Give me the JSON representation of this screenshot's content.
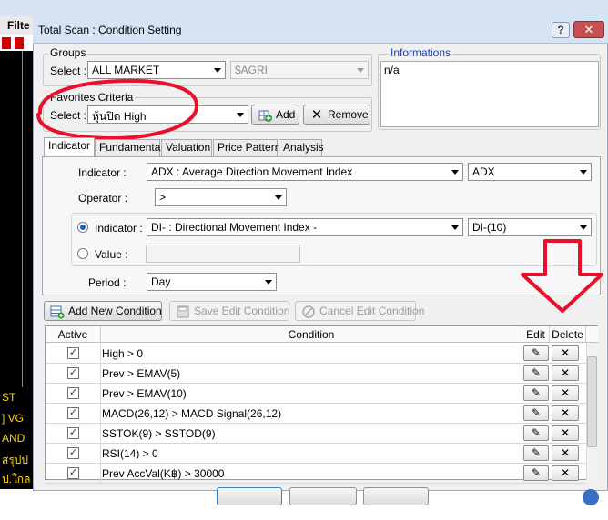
{
  "background_app": {
    "tab_label": "Filte",
    "text_lines": [
      "ST",
      "] VG",
      "AND",
      "สรุปป",
      "ป.ใกล"
    ]
  },
  "dialog": {
    "title": "Total Scan : Condition Setting",
    "help_glyph": "?",
    "close_glyph": "✕"
  },
  "groups": {
    "legend": "Groups",
    "select_label": "Select :",
    "market_value": "ALL MARKET",
    "sector_value": "$AGRI"
  },
  "favorites": {
    "legend": "Favorites Criteria",
    "select_label": "Select :",
    "value": "หุ้นปิด High",
    "add_label": "Add",
    "remove_label": "Remove"
  },
  "informations": {
    "legend": "Informations",
    "text": "n/a"
  },
  "tabs": [
    {
      "label": "Indicator",
      "active": true
    },
    {
      "label": "Fundamental",
      "active": false
    },
    {
      "label": "Valuation",
      "active": false
    },
    {
      "label": "Price Pattern",
      "active": false
    },
    {
      "label": "Analysis",
      "active": false
    }
  ],
  "indicator_tab": {
    "indicator_label": "Indicator :",
    "indicator_value": "ADX : Average Direction Movement Index",
    "indicator_param": "ADX",
    "operator_label": "Operator :",
    "operator_value": ">",
    "compare_indicator_label": "Indicator :",
    "compare_indicator_value": "DI- : Directional Movement Index -",
    "compare_indicator_param": "DI-(10)",
    "value_label": "Value :",
    "value_value": "",
    "period_label": "Period :",
    "period_value": "Day"
  },
  "condition_buttons": {
    "add": "Add New Condition",
    "save": "Save Edit Condition",
    "cancel": "Cancel Edit Condition"
  },
  "grid": {
    "headers": {
      "active": "Active",
      "condition": "Condition",
      "edit": "Edit",
      "delete": "Delete"
    },
    "check_glyph": "✓",
    "edit_glyph": "✎",
    "delete_glyph": "✕",
    "rows": [
      {
        "active": true,
        "condition": "High > 0"
      },
      {
        "active": true,
        "condition": "Prev > EMAV(5)"
      },
      {
        "active": true,
        "condition": "Prev > EMAV(10)"
      },
      {
        "active": true,
        "condition": "MACD(26,12) > MACD Signal(26,12)"
      },
      {
        "active": true,
        "condition": "SSTOK(9) > SSTOD(9)"
      },
      {
        "active": true,
        "condition": "RSI(14) > 0"
      },
      {
        "active": true,
        "condition": "Prev AccVal(K฿) > 30000"
      }
    ]
  },
  "colors": {
    "annotation_red": "#e8102a",
    "title_bar": "#d5e3f4",
    "close_button": "#c75050",
    "info_legend": "#1f3fb0"
  }
}
